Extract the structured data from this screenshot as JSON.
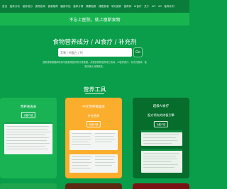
{
  "nav": {
    "items": [
      "首页",
      "营养分析",
      "营养成分",
      "食物查询",
      "食谱推荐",
      "膳食评估",
      "营养计算",
      "健康指数",
      "减肥食谱",
      "孕妇营养",
      "营养师",
      "AI食疗",
      "关于",
      "API",
      "AR",
      "营养补剂"
    ]
  },
  "slogan": "不忘上医院，就上瘦斯食物",
  "hero": {
    "title": "食物营养成分 / AI食疗 / 补充剂",
    "search_placeholder": "苹果 / 鸡蛋白 / 钙",
    "search_button": "Go",
    "description": "瘦斯食物数据库收录中国食物营养成分表数据，并提供食物营养成分查询、AI营养食疗、补充剂推荐、健康饮食计划等服务。"
  },
  "tools": {
    "section_title": "营养工具",
    "cards": [
      {
        "title": "营养速查表",
        "link": "功能介绍"
      },
      {
        "title": "中文营养数据库",
        "subtitle": "补充营养",
        "link": "功能介绍"
      },
      {
        "title": "超级AI食疗",
        "subtitle": "配方领先的终极引擎",
        "link": "功能介绍"
      }
    ]
  },
  "colors": {
    "background": "#0a9e4a",
    "nav": "#0b7d3b",
    "slogan_bar": "#18b450",
    "card_green": "#19b354",
    "card_orange": "#fbad2c",
    "card_dark": "#066d2d"
  }
}
